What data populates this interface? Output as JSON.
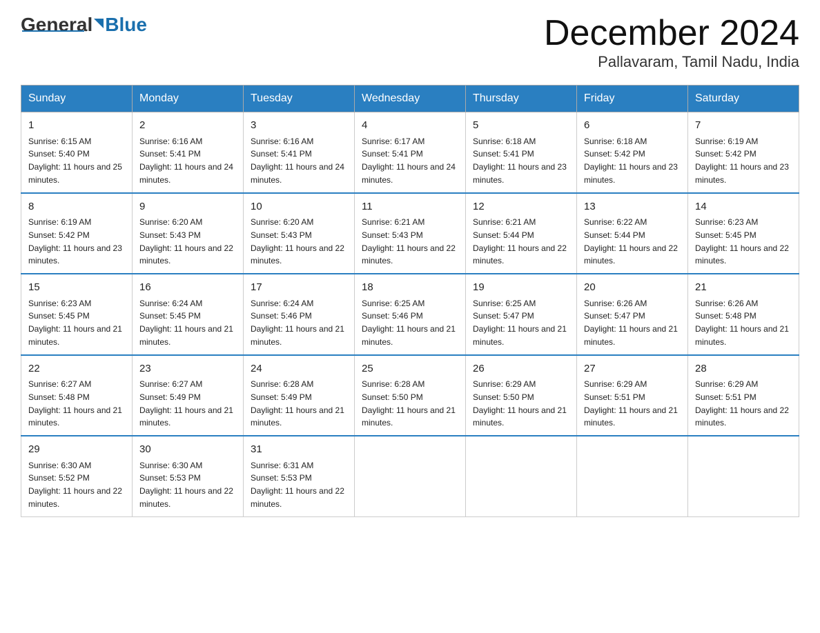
{
  "header": {
    "logo_general": "General",
    "logo_blue": "Blue",
    "month_title": "December 2024",
    "location": "Pallavaram, Tamil Nadu, India"
  },
  "weekdays": [
    "Sunday",
    "Monday",
    "Tuesday",
    "Wednesday",
    "Thursday",
    "Friday",
    "Saturday"
  ],
  "weeks": [
    [
      {
        "day": 1,
        "sunrise": "6:15 AM",
        "sunset": "5:40 PM",
        "daylight": "11 hours and 25 minutes."
      },
      {
        "day": 2,
        "sunrise": "6:16 AM",
        "sunset": "5:41 PM",
        "daylight": "11 hours and 24 minutes."
      },
      {
        "day": 3,
        "sunrise": "6:16 AM",
        "sunset": "5:41 PM",
        "daylight": "11 hours and 24 minutes."
      },
      {
        "day": 4,
        "sunrise": "6:17 AM",
        "sunset": "5:41 PM",
        "daylight": "11 hours and 24 minutes."
      },
      {
        "day": 5,
        "sunrise": "6:18 AM",
        "sunset": "5:41 PM",
        "daylight": "11 hours and 23 minutes."
      },
      {
        "day": 6,
        "sunrise": "6:18 AM",
        "sunset": "5:42 PM",
        "daylight": "11 hours and 23 minutes."
      },
      {
        "day": 7,
        "sunrise": "6:19 AM",
        "sunset": "5:42 PM",
        "daylight": "11 hours and 23 minutes."
      }
    ],
    [
      {
        "day": 8,
        "sunrise": "6:19 AM",
        "sunset": "5:42 PM",
        "daylight": "11 hours and 23 minutes."
      },
      {
        "day": 9,
        "sunrise": "6:20 AM",
        "sunset": "5:43 PM",
        "daylight": "11 hours and 22 minutes."
      },
      {
        "day": 10,
        "sunrise": "6:20 AM",
        "sunset": "5:43 PM",
        "daylight": "11 hours and 22 minutes."
      },
      {
        "day": 11,
        "sunrise": "6:21 AM",
        "sunset": "5:43 PM",
        "daylight": "11 hours and 22 minutes."
      },
      {
        "day": 12,
        "sunrise": "6:21 AM",
        "sunset": "5:44 PM",
        "daylight": "11 hours and 22 minutes."
      },
      {
        "day": 13,
        "sunrise": "6:22 AM",
        "sunset": "5:44 PM",
        "daylight": "11 hours and 22 minutes."
      },
      {
        "day": 14,
        "sunrise": "6:23 AM",
        "sunset": "5:45 PM",
        "daylight": "11 hours and 22 minutes."
      }
    ],
    [
      {
        "day": 15,
        "sunrise": "6:23 AM",
        "sunset": "5:45 PM",
        "daylight": "11 hours and 21 minutes."
      },
      {
        "day": 16,
        "sunrise": "6:24 AM",
        "sunset": "5:45 PM",
        "daylight": "11 hours and 21 minutes."
      },
      {
        "day": 17,
        "sunrise": "6:24 AM",
        "sunset": "5:46 PM",
        "daylight": "11 hours and 21 minutes."
      },
      {
        "day": 18,
        "sunrise": "6:25 AM",
        "sunset": "5:46 PM",
        "daylight": "11 hours and 21 minutes."
      },
      {
        "day": 19,
        "sunrise": "6:25 AM",
        "sunset": "5:47 PM",
        "daylight": "11 hours and 21 minutes."
      },
      {
        "day": 20,
        "sunrise": "6:26 AM",
        "sunset": "5:47 PM",
        "daylight": "11 hours and 21 minutes."
      },
      {
        "day": 21,
        "sunrise": "6:26 AM",
        "sunset": "5:48 PM",
        "daylight": "11 hours and 21 minutes."
      }
    ],
    [
      {
        "day": 22,
        "sunrise": "6:27 AM",
        "sunset": "5:48 PM",
        "daylight": "11 hours and 21 minutes."
      },
      {
        "day": 23,
        "sunrise": "6:27 AM",
        "sunset": "5:49 PM",
        "daylight": "11 hours and 21 minutes."
      },
      {
        "day": 24,
        "sunrise": "6:28 AM",
        "sunset": "5:49 PM",
        "daylight": "11 hours and 21 minutes."
      },
      {
        "day": 25,
        "sunrise": "6:28 AM",
        "sunset": "5:50 PM",
        "daylight": "11 hours and 21 minutes."
      },
      {
        "day": 26,
        "sunrise": "6:29 AM",
        "sunset": "5:50 PM",
        "daylight": "11 hours and 21 minutes."
      },
      {
        "day": 27,
        "sunrise": "6:29 AM",
        "sunset": "5:51 PM",
        "daylight": "11 hours and 21 minutes."
      },
      {
        "day": 28,
        "sunrise": "6:29 AM",
        "sunset": "5:51 PM",
        "daylight": "11 hours and 22 minutes."
      }
    ],
    [
      {
        "day": 29,
        "sunrise": "6:30 AM",
        "sunset": "5:52 PM",
        "daylight": "11 hours and 22 minutes."
      },
      {
        "day": 30,
        "sunrise": "6:30 AM",
        "sunset": "5:53 PM",
        "daylight": "11 hours and 22 minutes."
      },
      {
        "day": 31,
        "sunrise": "6:31 AM",
        "sunset": "5:53 PM",
        "daylight": "11 hours and 22 minutes."
      },
      null,
      null,
      null,
      null
    ]
  ]
}
